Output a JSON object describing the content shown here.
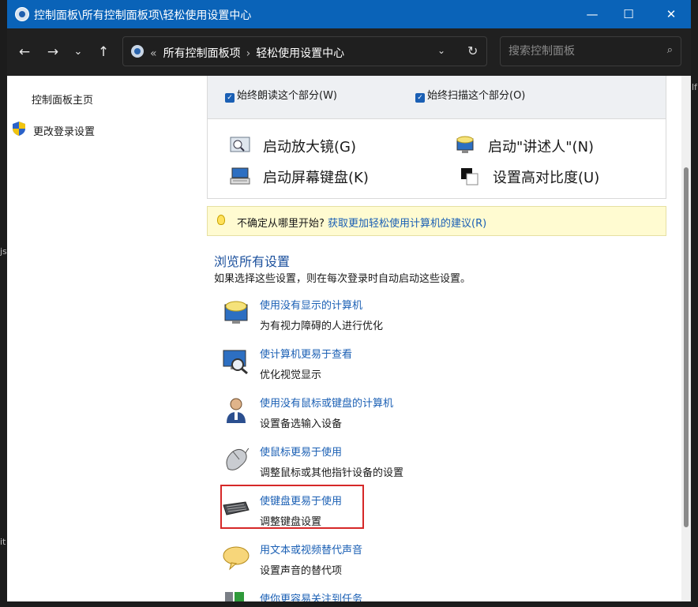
{
  "window": {
    "title": "控制面板\\所有控制面板项\\轻松使用设置中心",
    "minimize_glyph": "—",
    "maximize_glyph": "☐",
    "close_glyph": "✕"
  },
  "nav": {
    "back_glyph": "←",
    "forward_glyph": "→",
    "recent_glyph": "⌄",
    "up_glyph": "↑",
    "breadcrumb_prefix": "«",
    "breadcrumb": [
      "所有控制面板项",
      "轻松使用设置中心"
    ],
    "breadcrumb_sep": "›",
    "dropdown_glyph": "⌄",
    "refresh_glyph": "↻"
  },
  "search": {
    "placeholder": "搜索控制面板"
  },
  "sidebar": {
    "home": "控制面板主页",
    "login_settings": "更改登录设置"
  },
  "quick_access": {
    "read_aloud": "始终朗读这个部分(W)",
    "scan": "始终扫描这个部分(O)",
    "tools": {
      "magnifier": "启动放大镜(G)",
      "narrator": "启动\"讲述人\"(N)",
      "osk": "启动屏幕键盘(K)",
      "contrast": "设置高对比度(U)"
    }
  },
  "tip": {
    "prefix": "不确定从哪里开始?",
    "link": "获取更加轻松使用计算机的建议(R)"
  },
  "browse": {
    "heading": "浏览所有设置",
    "description": "如果选择这些设置，则在每次登录时自动启动这些设置。",
    "items": [
      {
        "title": "使用没有显示的计算机",
        "subtitle": "为有视力障碍的人进行优化",
        "icon": "monitor-speech-icon"
      },
      {
        "title": "使计算机更易于查看",
        "subtitle": "优化视觉显示",
        "icon": "monitor-magnifier-icon"
      },
      {
        "title": "使用没有鼠标或键盘的计算机",
        "subtitle": "设置备选输入设备",
        "icon": "person-icon"
      },
      {
        "title": "使鼠标更易于使用",
        "subtitle": "调整鼠标或其他指针设备的设置",
        "icon": "mouse-icon"
      },
      {
        "title": "使键盘更易于使用",
        "subtitle": "调整键盘设置",
        "icon": "keyboard-icon"
      },
      {
        "title": "用文本或视频替代声音",
        "subtitle": "设置声音的替代项",
        "icon": "speech-bubble-icon"
      },
      {
        "title": "使你更容易关注到任务",
        "subtitle": "",
        "icon": "users-icon"
      }
    ]
  },
  "colors": {
    "titlebar": "#0a63b8",
    "link": "#1a5fb4",
    "highlight_box": "#d62828"
  }
}
